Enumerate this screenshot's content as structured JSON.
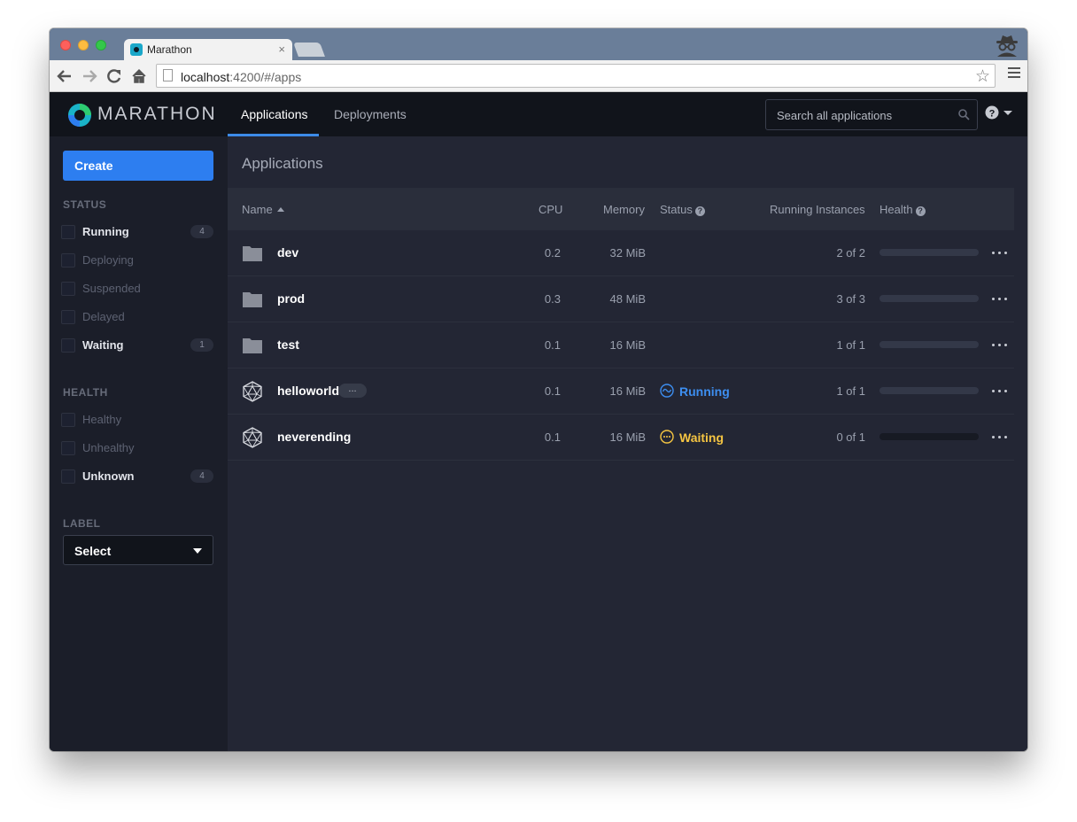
{
  "browser": {
    "tab_title": "Marathon",
    "tab_close": "×",
    "url_host": "localhost",
    "url_rest": ":4200/#/apps"
  },
  "app": {
    "brand": "MARATHON",
    "nav": [
      {
        "label": "Applications",
        "active": true
      },
      {
        "label": "Deployments",
        "active": false
      }
    ],
    "search_placeholder": "Search all applications"
  },
  "sidebar": {
    "create_label": "Create",
    "status_heading": "STATUS",
    "status_filters": [
      {
        "label": "Running",
        "count": "4"
      },
      {
        "label": "Deploying",
        "count": ""
      },
      {
        "label": "Suspended",
        "count": ""
      },
      {
        "label": "Delayed",
        "count": ""
      },
      {
        "label": "Waiting",
        "count": "1"
      }
    ],
    "health_heading": "HEALTH",
    "health_filters": [
      {
        "label": "Healthy",
        "count": ""
      },
      {
        "label": "Unhealthy",
        "count": ""
      },
      {
        "label": "Unknown",
        "count": "4"
      }
    ],
    "label_heading": "LABEL",
    "label_select": "Select"
  },
  "main": {
    "title": "Applications",
    "columns": {
      "name": "Name",
      "cpu": "CPU",
      "memory": "Memory",
      "status": "Status",
      "instances": "Running Instances",
      "health": "Health"
    },
    "rows": [
      {
        "name": "dev",
        "icon": "folder-icon",
        "cpu": "0.2",
        "memory": "32 MiB",
        "status": "",
        "instances": "2 of 2",
        "health_fill": 1.0
      },
      {
        "name": "prod",
        "icon": "folder-icon",
        "cpu": "0.3",
        "memory": "48 MiB",
        "status": "",
        "instances": "3 of 3",
        "health_fill": 1.0
      },
      {
        "name": "test",
        "icon": "folder-icon",
        "cpu": "0.1",
        "memory": "16 MiB",
        "status": "",
        "instances": "1 of 1",
        "health_fill": 1.0
      },
      {
        "name": "helloworld",
        "icon": "app-icon",
        "badge": "...",
        "cpu": "0.1",
        "memory": "16 MiB",
        "status": "Running",
        "status_color": "#3d8ef0",
        "instances": "1 of 1",
        "health_fill": 1.0
      },
      {
        "name": "neverending",
        "icon": "app-icon",
        "cpu": "0.1",
        "memory": "16 MiB",
        "status": "Waiting",
        "status_color": "#f5c542",
        "instances": "0 of 1",
        "health_fill": 0.0
      }
    ]
  },
  "colors": {
    "accent": "#2d7ef0",
    "running": "#3d8ef0",
    "waiting": "#f5c542",
    "background": "#232634"
  }
}
